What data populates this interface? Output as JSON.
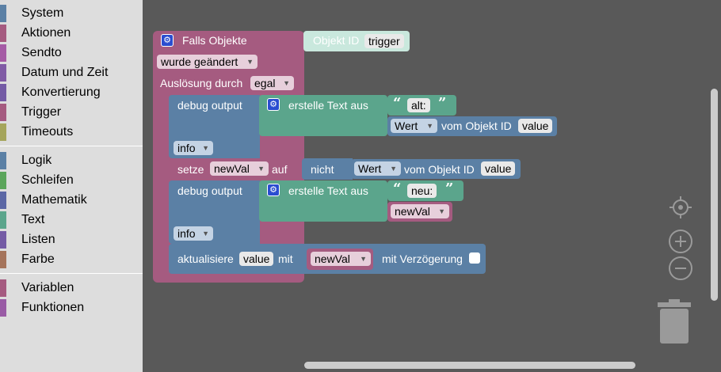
{
  "toolbox": {
    "items": [
      {
        "label": "System",
        "color": "#5b80a5"
      },
      {
        "label": "Aktionen",
        "color": "#a55b80"
      },
      {
        "label": "Sendto",
        "color": "#a55ba5"
      },
      {
        "label": "Datum und Zeit",
        "color": "#805ba5"
      },
      {
        "label": "Konvertierung",
        "color": "#745ba5"
      },
      {
        "label": "Trigger",
        "color": "#a55b80"
      },
      {
        "label": "Timeouts",
        "color": "#a5a55b"
      },
      {
        "label": "Logik",
        "color": "#5b80a5"
      },
      {
        "label": "Schleifen",
        "color": "#5ba55b"
      },
      {
        "label": "Mathematik",
        "color": "#5b67a5"
      },
      {
        "label": "Text",
        "color": "#5ba58c"
      },
      {
        "label": "Listen",
        "color": "#745ba5"
      },
      {
        "label": "Farbe",
        "color": "#a5745b"
      },
      {
        "label": "Variablen",
        "color": "#a55b80"
      },
      {
        "label": "Funktionen",
        "color": "#995ba5"
      }
    ]
  },
  "colors": {
    "trigger": "#a55b80",
    "system": "#5b80a5",
    "text": "#5ba58c",
    "variable": "#a55b80",
    "shadow": "#c9e8dd"
  },
  "icons": {
    "gear": "gear-icon",
    "trash": "trash-icon",
    "target": "target-icon",
    "zoom_in": "zoom-in-icon",
    "zoom_out": "zoom-out-icon"
  },
  "blocks": {
    "trigger": {
      "title": "Falls Objekte",
      "event": "wurde geändert",
      "ausloesung_label": "Auslösung durch",
      "ausloesung_value": "egal",
      "objekt_id_label": "Objekt ID",
      "objekt_id_value": "trigger"
    },
    "debug1": {
      "label": "debug output",
      "create_text": "erstelle Text aus",
      "text_value": "alt:",
      "wert": "Wert",
      "vom_objekt": "vom Objekt ID",
      "id_value": "value",
      "level": "info"
    },
    "setze": {
      "label": "setze",
      "var": "newVal",
      "auf": "auf",
      "nicht": "nicht",
      "wert": "Wert",
      "vom_objekt": "vom Objekt ID",
      "id_value": "value"
    },
    "debug2": {
      "label": "debug output",
      "create_text": "erstelle Text aus",
      "text_value": "neu:",
      "var": "newVal",
      "level": "info"
    },
    "update": {
      "label": "aktualisiere",
      "id_value": "value",
      "mit": "mit",
      "var": "newVal",
      "delay": "mit Verzögerung"
    }
  },
  "glyphs": {
    "open_quote": "“",
    "close_quote": "”",
    "arrow": "▼",
    "gear": "⚙"
  }
}
